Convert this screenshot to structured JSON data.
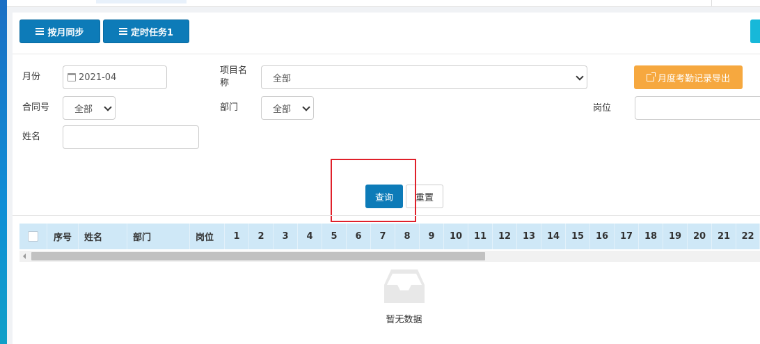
{
  "toolbar": {
    "sync_month_label": "按月同步",
    "scheduled_task_label": "定时任务1"
  },
  "filters": {
    "month_label": "月份",
    "month_value": "2021-04",
    "project_name_label": "项目名称",
    "project_name_value": "全部",
    "contract_no_label": "合同号",
    "contract_no_value": "全部",
    "department_label": "部门",
    "department_value": "全部",
    "position_label": "岗位",
    "position_value": "",
    "name_label": "姓名",
    "name_value": ""
  },
  "actions": {
    "export_label": "月度考勤记录导出",
    "query_label": "查询",
    "reset_label": "重置"
  },
  "table": {
    "columns": [
      "序号",
      "姓名",
      "部门",
      "岗位",
      "1",
      "2",
      "3",
      "4",
      "5",
      "6",
      "7",
      "8",
      "9",
      "10",
      "11",
      "12",
      "13",
      "14",
      "15",
      "16",
      "17",
      "18",
      "19",
      "20",
      "21",
      "22"
    ],
    "empty_text": "暂无数据"
  },
  "colors": {
    "primary": "#0d7bb8",
    "export": "#f6a83f",
    "header_bg": "#cfe8f7",
    "highlight": "#e0202a"
  },
  "icons": {
    "toolbar": "list-icon",
    "month": "calendar-icon",
    "export": "external-link-icon",
    "empty": "inbox-icon"
  }
}
